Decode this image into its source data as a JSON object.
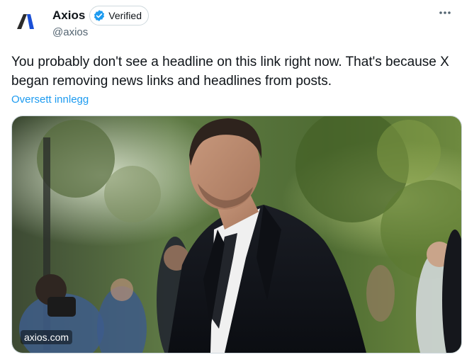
{
  "author": {
    "display_name": "Axios",
    "handle": "@axios",
    "verified_label": "Verified",
    "avatar_icon": "axios-logo-icon"
  },
  "tweet": {
    "text": "You probably don't see a headline on this link right now. That's because X\nbegan removing news links and headlines from posts.",
    "translate_label": "Oversett innlegg"
  },
  "card": {
    "domain": "axios.com",
    "image_description_icon": "link-preview-photo"
  },
  "colors": {
    "accent": "#1d9bf0",
    "text_primary": "#0f1419",
    "text_secondary": "#536471",
    "border": "#cfd9de"
  },
  "icons": {
    "more": "more-dots-icon",
    "verified": "verified-badge-icon"
  }
}
